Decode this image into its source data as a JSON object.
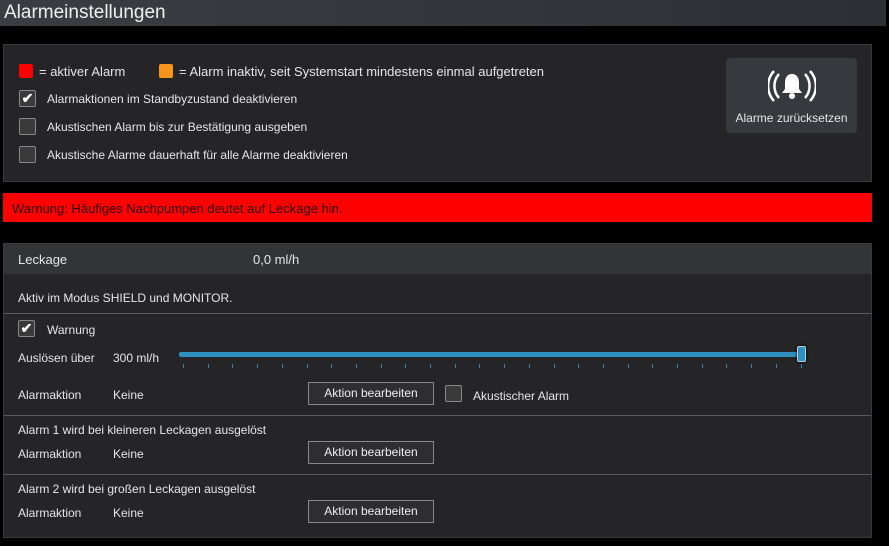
{
  "title": "Alarmeinstellungen",
  "legend": {
    "active_color": "#ff0000",
    "active_label": "= aktiver Alarm",
    "inactive_color": "#f7941d",
    "inactive_label": "= Alarm inaktiv, seit Systemstart mindestens einmal aufgetreten"
  },
  "options": [
    {
      "label": "Alarmaktionen im Standbyzustand deaktivieren",
      "checked": true
    },
    {
      "label": "Akustischen Alarm bis zur Bestätigung ausgeben",
      "checked": false
    },
    {
      "label": "Akustische Alarme dauerhaft für alle Alarme deaktivieren",
      "checked": false
    }
  ],
  "reset_button": {
    "label": "Alarme zurücksetzen",
    "icon": "bell-ringing-icon"
  },
  "banner": {
    "text": "Warnung: Häufiges Nachpumpen deutet auf Leckage hin.",
    "color": "#ff0000"
  },
  "leak": {
    "name": "Leckage",
    "value": "0,0 ml/h",
    "mode_text": "Aktiv im Modus SHIELD und MONITOR.",
    "warning": {
      "label": "Warnung",
      "checked": true,
      "trigger_label": "Auslösen über",
      "trigger_value": "300 ml/h",
      "slider_fraction": 1.0,
      "action_label": "Alarmaktion",
      "action_value": "Keine",
      "edit_label": "Aktion bearbeiten",
      "acoustic_label": "Akustischer Alarm",
      "acoustic_checked": false
    },
    "alarm1": {
      "title": "Alarm 1 wird bei kleineren Leckagen ausgelöst",
      "action_label": "Alarmaktion",
      "action_value": "Keine",
      "edit_label": "Aktion bearbeiten"
    },
    "alarm2": {
      "title": "Alarm 2 wird bei großen Leckagen ausgelöst",
      "action_label": "Alarmaktion",
      "action_value": "Keine",
      "edit_label": "Aktion bearbeiten"
    }
  }
}
